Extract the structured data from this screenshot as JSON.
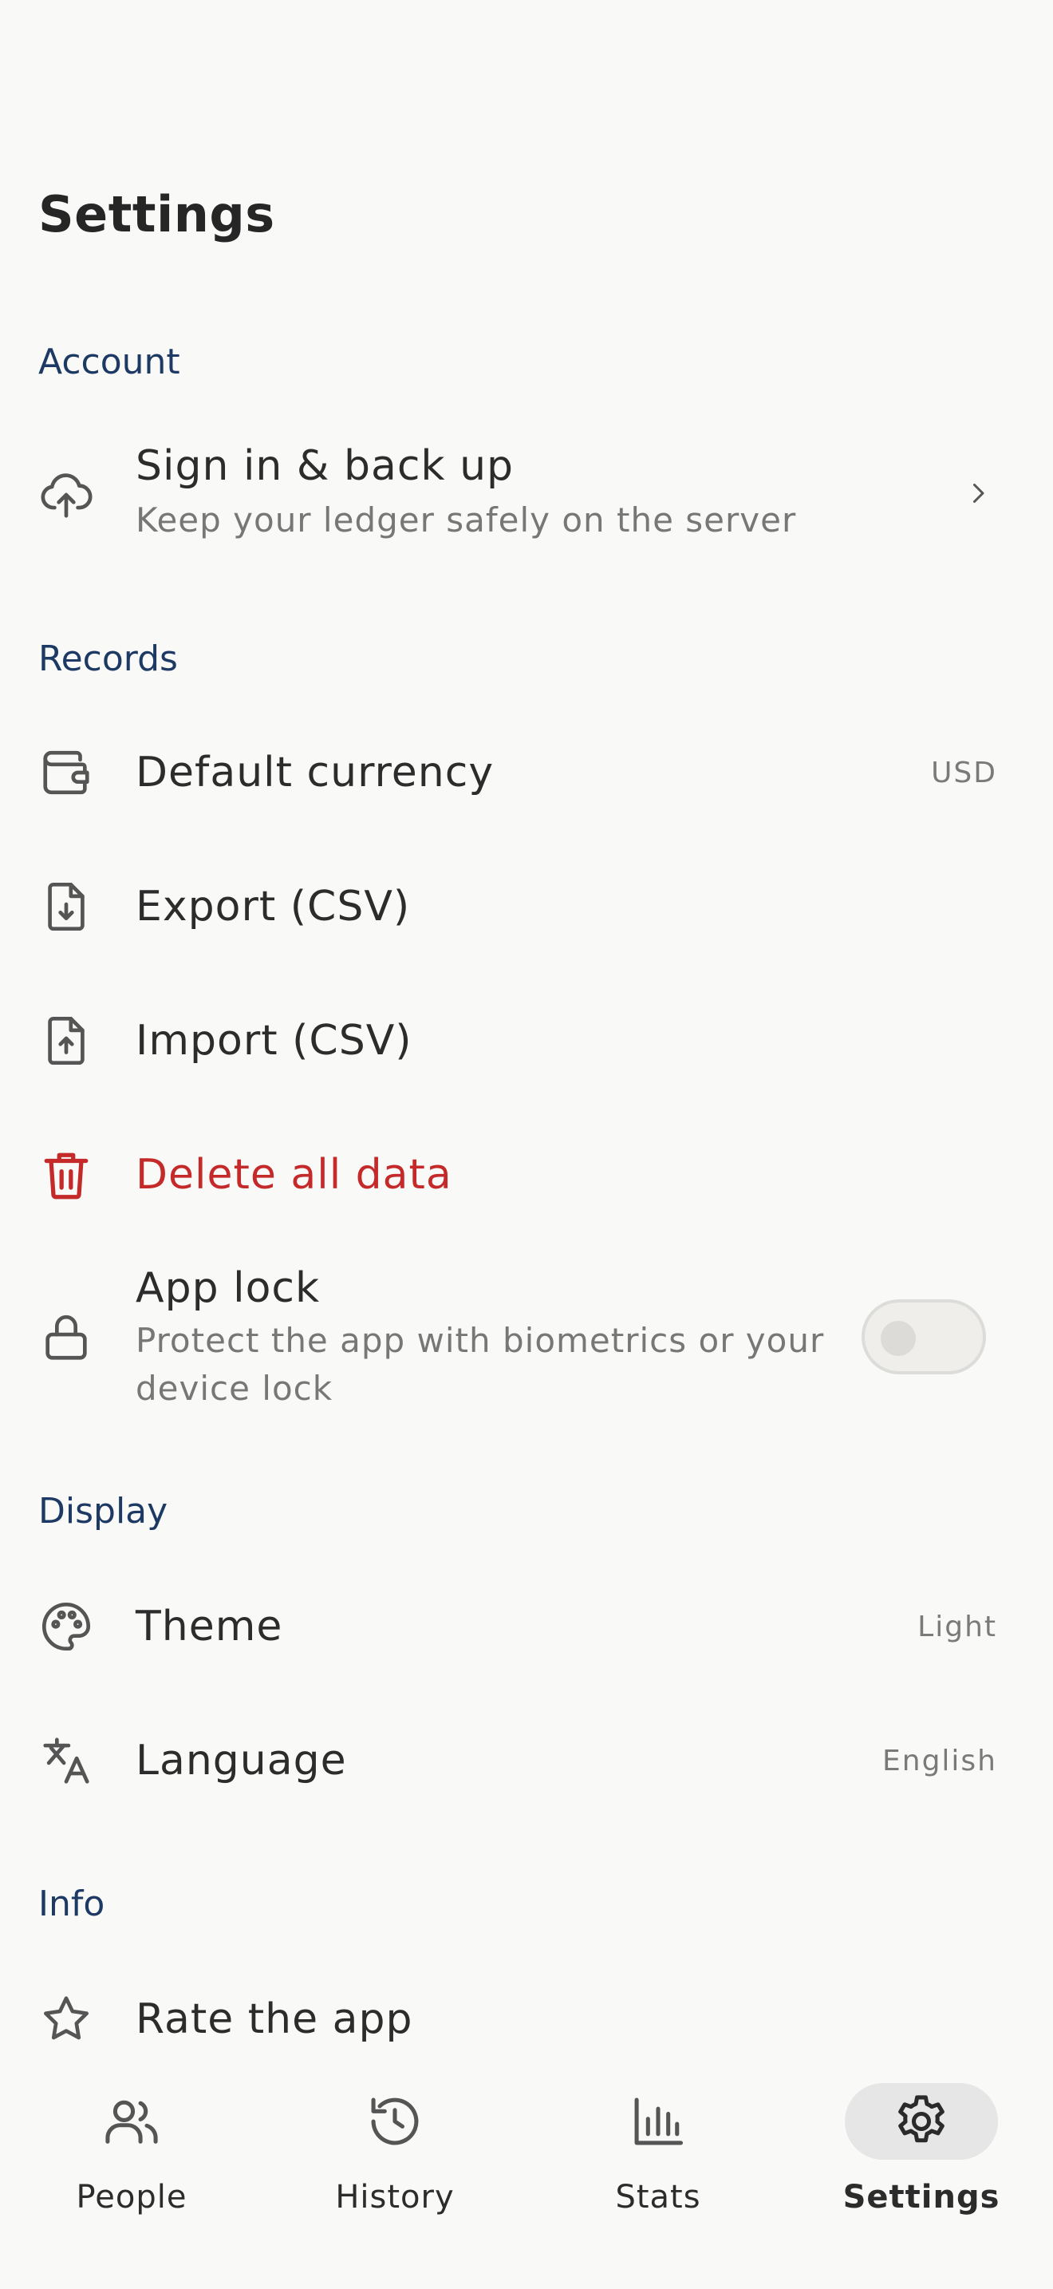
{
  "header": {
    "title": "Settings"
  },
  "sections": {
    "account": "Account",
    "records": "Records",
    "display": "Display",
    "info": "Info"
  },
  "account": {
    "signin_title": "Sign in & back up",
    "signin_subtitle": "Keep your ledger safely on the server"
  },
  "records": {
    "currency_label": "Default currency",
    "currency_value": "USD",
    "export_label": "Export (CSV)",
    "import_label": "Import (CSV)",
    "delete_label": "Delete all data",
    "applock_label": "App lock",
    "applock_subtitle_1": "Protect the app with biometrics or your",
    "applock_subtitle_2": "device lock",
    "applock_enabled": false
  },
  "display": {
    "theme_label": "Theme",
    "theme_value": "Light",
    "language_label": "Language",
    "language_value": "English"
  },
  "info": {
    "rate_label": "Rate the app"
  },
  "nav": {
    "items": [
      {
        "label": "People",
        "icon": "people-icon",
        "active": false
      },
      {
        "label": "History",
        "icon": "history-icon",
        "active": false
      },
      {
        "label": "Stats",
        "icon": "stats-icon",
        "active": false
      },
      {
        "label": "Settings",
        "icon": "gear-icon",
        "active": true
      }
    ]
  },
  "colors": {
    "accent_section": "#1d3a64",
    "danger": "#c42a2a",
    "background": "#f9f9f7"
  }
}
